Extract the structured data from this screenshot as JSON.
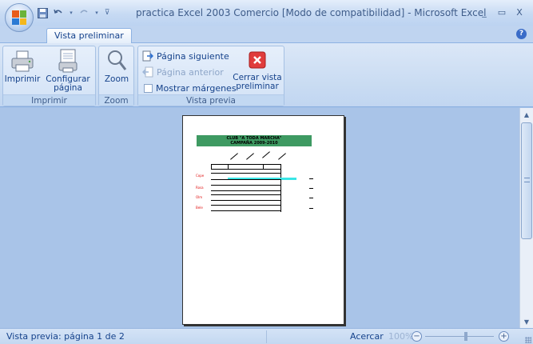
{
  "window": {
    "title": "practica Excel 2003 Comercio  [Modo de compatibilidad] - Microsoft Excel",
    "controls": [
      "_",
      "▭",
      "X"
    ]
  },
  "quick_access": {
    "items": [
      "save-icon",
      "undo-icon",
      "redo-icon",
      "customize-icon"
    ]
  },
  "tab": {
    "label": "Vista preliminar"
  },
  "ribbon": {
    "groups": {
      "imprimir": {
        "label": "Imprimir",
        "print_label": "Imprimir",
        "setup_label_line1": "Configurar",
        "setup_label_line2": "página"
      },
      "zoom": {
        "label": "Zoom",
        "zoom_label": "Zoom"
      },
      "vista_previa": {
        "label": "Vista previa",
        "next_page": "Página siguiente",
        "prev_page": "Página anterior",
        "show_margins": "Mostrar márgenes",
        "close_line1": "Cerrar vista",
        "close_line2": "preliminar"
      }
    }
  },
  "preview": {
    "header_line1": "CLUB \"A TODA MARCHA\"",
    "header_line2": "CAMPAÑA 2009-2010",
    "row_labels": [
      "Cope",
      "Rosa",
      "Olm",
      "Bele"
    ],
    "colors": {
      "header_band": "#3e9a62",
      "highlight": "#39e6e6",
      "red_labels": "#e01010"
    }
  },
  "status": {
    "left_text": "Vista previa: página 1 de 2",
    "zoom_label": "Acercar",
    "zoom_value": "100%"
  },
  "colors": {
    "ribbon_text": "#15428b",
    "workspace_bg": "#a9c4e8",
    "close_button": "#e03c3c"
  }
}
